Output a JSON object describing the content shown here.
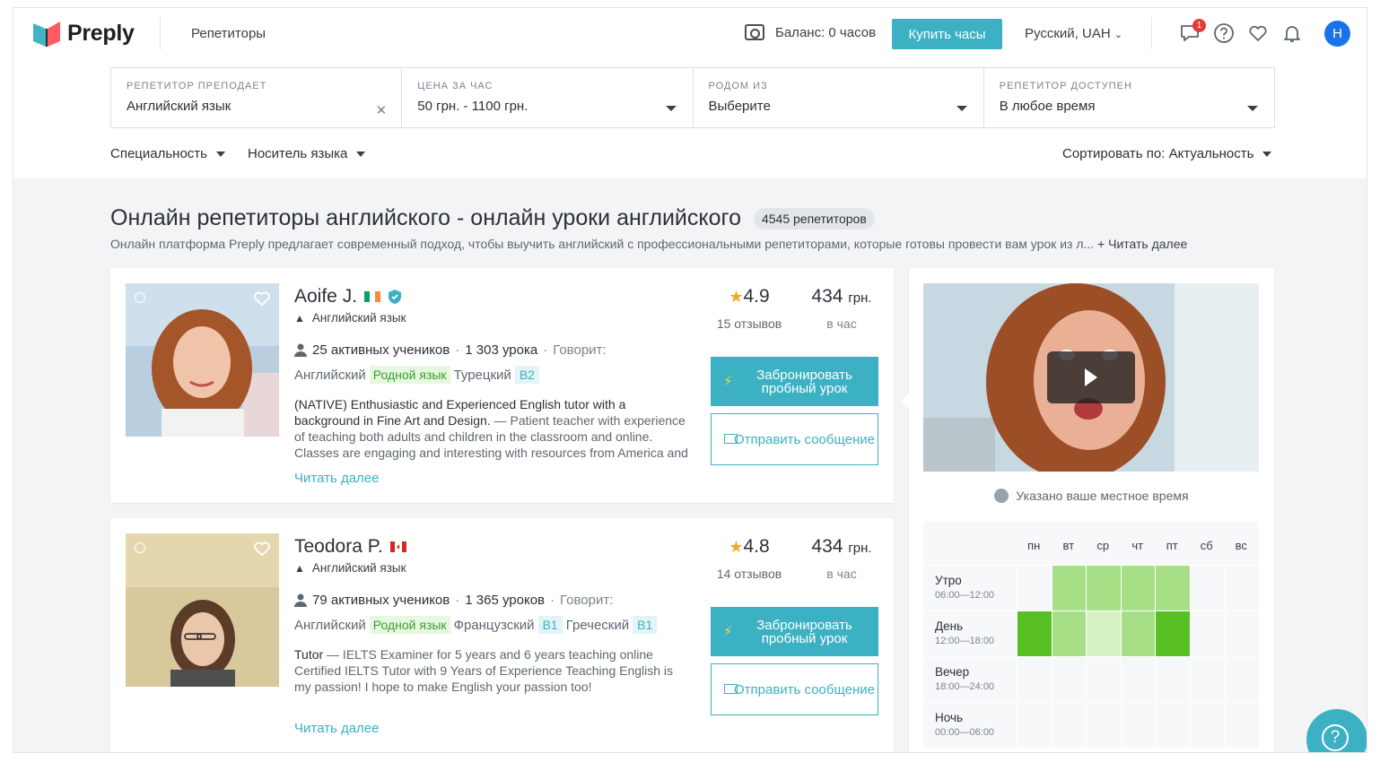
{
  "brand": {
    "name": "Preply"
  },
  "nav": {
    "tutors_link": "Репетиторы"
  },
  "header": {
    "balance": "Баланс: 0 часов",
    "buy_button": "Купить часы",
    "language": "Русский, UAH",
    "notifications_count": "1",
    "user_initial": "H",
    "icons": [
      "chat-icon",
      "help-icon",
      "heart-icon",
      "bell-icon"
    ]
  },
  "filters": [
    {
      "label": "РЕПЕТИТОР ПРЕПОДАЕТ",
      "value": "Английский язык",
      "control": "clear"
    },
    {
      "label": "ЦЕНА ЗА ЧАС",
      "value": "50 грн. - 1100 грн.",
      "control": "dropdown"
    },
    {
      "label": "РОДОМ ИЗ",
      "value": "Выберите",
      "control": "dropdown"
    },
    {
      "label": "РЕПЕТИТОР ДОСТУПЕН",
      "value": "В любое время",
      "control": "dropdown"
    }
  ],
  "subfilters": {
    "specialty": "Специальность",
    "native": "Носитель языка",
    "sort": "Сортировать по: Актуальность"
  },
  "page": {
    "title": "Онлайн репетиторы английского - онлайн уроки английского",
    "count": "4545 репетиторов",
    "description": "Онлайн платформа Preply предлагает современный подход, чтобы выучить английский с профессиональными репетиторами, которые готовы провести вам урок из л...",
    "read_more": "+ Читать далее"
  },
  "tutors": [
    {
      "name": "Aoife J.",
      "flag": "ireland-flag-icon",
      "subject": "Английский язык",
      "students": "25 активных учеников",
      "lessons": "1 303 урока",
      "speaks": "Говорит:",
      "languages": [
        {
          "name": "Английский",
          "level": "Родной язык",
          "native": true
        },
        {
          "name": "Турецкий",
          "level": "B2",
          "native": false
        }
      ],
      "bio_head": "(NATIVE) Enthusiastic and Experienced English tutor with a background in Fine Art and Design.",
      "bio": "— Patient teacher with experience of teaching both adults and children in the classroom and online. Classes are engaging and interesting with resources from America and the United",
      "read_more": "Читать далее",
      "rating": "4.9",
      "reviews": "15 отзывов",
      "price": "434",
      "currency": "грн.",
      "per": "в час",
      "book_button": "Забронировать пробный урок",
      "message_button": "Отправить сообщение",
      "accent": "#c98a5e"
    },
    {
      "name": "Teodora P.",
      "flag": "canada-flag-icon",
      "subject": "Английский язык",
      "students": "79 активных учеников",
      "lessons": "1 365 уроков",
      "speaks": "Говорит:",
      "languages": [
        {
          "name": "Английский",
          "level": "Родной язык",
          "native": true
        },
        {
          "name": "Французский",
          "level": "B1",
          "native": false
        },
        {
          "name": "Греческий",
          "level": "B1",
          "native": false
        }
      ],
      "bio_head": "Tutor",
      "bio": "— IELTS Examiner for 5 years and 6 years teaching online Certified IELTS Tutor with 9 Years of Experience Teaching English is my passion! I hope to make English your passion too!",
      "read_more": "Читать далее",
      "rating": "4.8",
      "reviews": "14 отзывов",
      "price": "434",
      "currency": "грн.",
      "per": "в час",
      "book_button": "Забронировать пробный урок",
      "message_button": "Отправить сообщение",
      "accent": "#6b4a35"
    }
  ],
  "side": {
    "local_time": "Указано ваше местное время",
    "days": [
      "пн",
      "вт",
      "ср",
      "чт",
      "пт",
      "сб",
      "вс"
    ],
    "rows": [
      {
        "name": "Утро",
        "time": "06:00—12:00",
        "levels": [
          0,
          2,
          2,
          2,
          2,
          0,
          0
        ]
      },
      {
        "name": "День",
        "time": "12:00—18:00",
        "levels": [
          3,
          2,
          1,
          2,
          3,
          0,
          0
        ]
      },
      {
        "name": "Вечер",
        "time": "18:00—24:00",
        "levels": [
          0,
          0,
          0,
          0,
          0,
          0,
          0
        ]
      },
      {
        "name": "Ночь",
        "time": "00:00—06:00",
        "levels": [
          0,
          0,
          0,
          0,
          0,
          0,
          0
        ]
      }
    ],
    "level_colors": [
      "#f7f8f9",
      "#d4f1c4",
      "#a7df87",
      "#57bf23"
    ]
  },
  "colors": {
    "accent": "#3cb1c3",
    "native_tag": "#3aa02f",
    "star": "#f5a623"
  }
}
